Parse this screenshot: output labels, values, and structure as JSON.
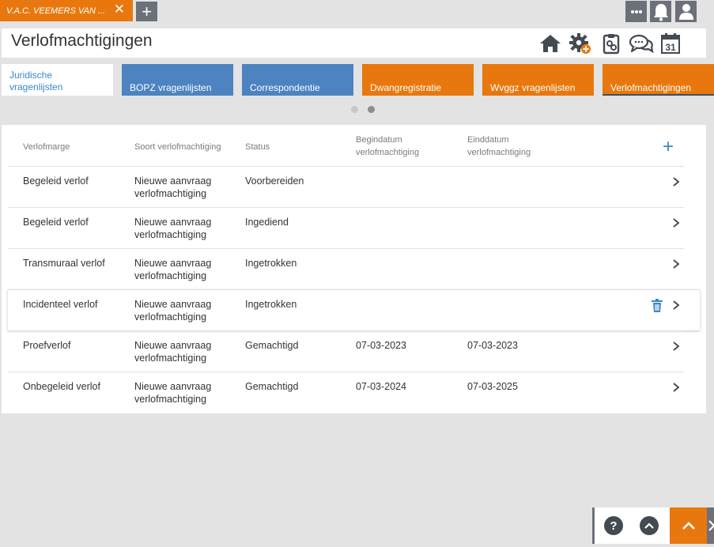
{
  "top": {
    "client_tab_label": "V.A.C. VEEMERS VAN ...",
    "client_tab_close": "✕",
    "add_tab": "+"
  },
  "header": {
    "title": "Verlofmachtigingen",
    "calendar_day": "31"
  },
  "tiles": [
    {
      "label": "Juridische vragenlijsten",
      "style": "white"
    },
    {
      "label": "BOPZ vragenlijsten",
      "style": "blue"
    },
    {
      "label": "Correspondentie",
      "style": "blue"
    },
    {
      "label": "Dwangregistratie",
      "style": "orange"
    },
    {
      "label": "Wvggz vragenlijsten",
      "style": "orange"
    },
    {
      "label": "Verlofmachtigingen",
      "style": "orange"
    }
  ],
  "table": {
    "headers": {
      "marge": "Verlofmarge",
      "soort": "Soort verlofmachtiging",
      "status": "Status",
      "begin": "Begindatum verlofmachtiging",
      "eind": "Einddatum verlofmachtiging"
    },
    "add_symbol": "+",
    "rows": [
      {
        "marge": "Begeleid verlof",
        "soort": "Nieuwe aanvraag verlofmachtiging",
        "status": "Voorbereiden",
        "begin": "",
        "eind": ""
      },
      {
        "marge": "Begeleid verlof",
        "soort": "Nieuwe aanvraag verlofmachtiging",
        "status": "Ingediend",
        "begin": "",
        "eind": ""
      },
      {
        "marge": "Transmuraal verlof",
        "soort": "Nieuwe aanvraag verlofmachtiging",
        "status": "Ingetrokken",
        "begin": "",
        "eind": ""
      },
      {
        "marge": "Incidenteel verlof",
        "soort": "Nieuwe aanvraag verlofmachtiging",
        "status": "Ingetrokken",
        "begin": "",
        "eind": ""
      },
      {
        "marge": "Proefverlof",
        "soort": "Nieuwe aanvraag verlofmachtiging",
        "status": "Gemachtigd",
        "begin": "07-03-2023",
        "eind": "07-03-2023"
      },
      {
        "marge": "Onbegeleid verlof",
        "soort": "Nieuwe aanvraag verlofmachtiging",
        "status": "Gemachtigd",
        "begin": "07-03-2024",
        "eind": "07-03-2025"
      }
    ]
  },
  "bottom": {
    "help": "?"
  },
  "colors": {
    "orange": "#e8780e",
    "blue": "#4d83c0",
    "link_blue": "#3a87c8",
    "dark_gray": "#6b7079"
  }
}
